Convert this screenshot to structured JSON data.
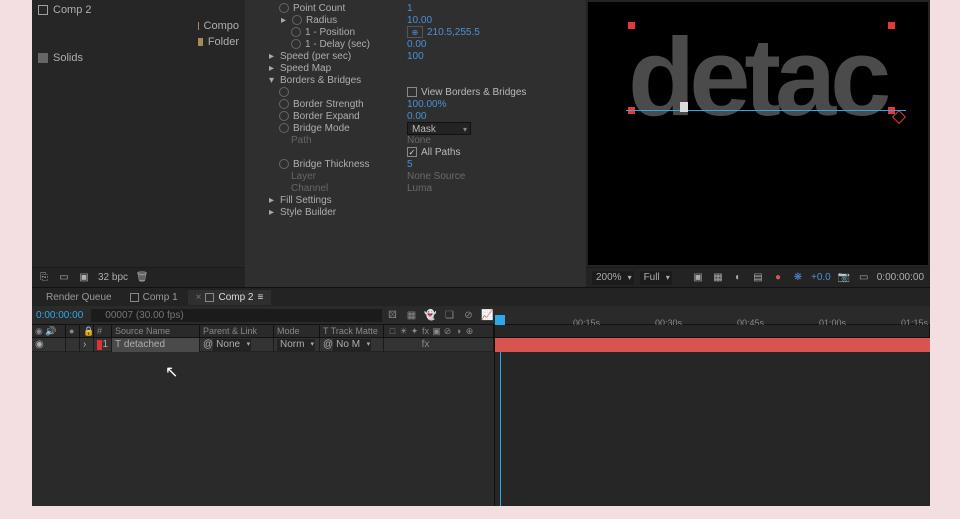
{
  "project": {
    "items": [
      {
        "name": "Comp 2",
        "kind": "comp"
      },
      {
        "name": "Compo",
        "kind": "folder"
      },
      {
        "name": "Folder",
        "kind": "folder"
      },
      {
        "name": "Solids",
        "kind": "solid"
      }
    ],
    "bpc": "32 bpc"
  },
  "effects": {
    "rows": [
      {
        "name": "Point Count",
        "value": "1",
        "indent": 2,
        "stopwatch": true
      },
      {
        "name": "Radius",
        "value": "10.00",
        "indent": 2,
        "stopwatch": true,
        "twirl": ">"
      },
      {
        "name": "1 - Position",
        "value": "210.5,255.5",
        "indent": 3,
        "stopwatch": true,
        "link": true
      },
      {
        "name": "1 - Delay (sec)",
        "value": "0.00",
        "indent": 3,
        "stopwatch": true
      },
      {
        "name": "Speed (per sec)",
        "value": "100",
        "indent": 1,
        "twirl": ">"
      },
      {
        "name": "Speed Map",
        "value": "",
        "indent": 1,
        "twirl": ">"
      },
      {
        "name": "Borders & Bridges",
        "value": "",
        "indent": 1,
        "twirl": "v"
      },
      {
        "name": "",
        "value": "View Borders & Bridges",
        "indent": 2,
        "stopwatch": true,
        "checkbox": false
      },
      {
        "name": "Border Strength",
        "value": "100.00%",
        "indent": 2,
        "stopwatch": true
      },
      {
        "name": "Border Expand",
        "value": "0.00",
        "indent": 2,
        "stopwatch": true
      },
      {
        "name": "Bridge Mode",
        "value": "Mask",
        "indent": 2,
        "stopwatch": true,
        "dropdown": true
      },
      {
        "name": "Path",
        "value": "None",
        "indent": 3,
        "dim": true
      },
      {
        "name": "",
        "value": "All Paths",
        "indent": 3,
        "checkbox": true
      },
      {
        "name": "Bridge Thickness",
        "value": "5",
        "indent": 2,
        "stopwatch": true
      },
      {
        "name": "Layer",
        "value": "None        Source",
        "indent": 3,
        "dim": true
      },
      {
        "name": "Channel",
        "value": "Luma",
        "indent": 3,
        "dim": true
      },
      {
        "name": "Fill Settings",
        "value": "",
        "indent": 1,
        "twirl": ">"
      },
      {
        "name": "Style Builder",
        "value": "",
        "indent": 1,
        "twirl": ">"
      }
    ]
  },
  "preview": {
    "text": "detac",
    "zoom": "200%",
    "res": "Full",
    "exposure": "+0.0",
    "timecode": "0:00:00:00"
  },
  "timeline": {
    "tabs": [
      {
        "label": "Render Queue",
        "active": false
      },
      {
        "label": "Comp 1",
        "active": false,
        "comp": true
      },
      {
        "label": "Comp 2",
        "active": true,
        "comp": true
      }
    ],
    "current_time": "0:00:00:00",
    "fps_hint": "00007 (30.00 fps)",
    "ruler": [
      "00:15s",
      "00:30s",
      "00:45s",
      "01:00s",
      "01:15s"
    ],
    "columns": {
      "source": "Source Name",
      "parent": "Parent & Link",
      "mode": "Mode",
      "track": "T  Track Matte"
    },
    "layer": {
      "index": "1",
      "name": "detached",
      "parent": "None",
      "mode": "Norm",
      "matte": "No M"
    }
  }
}
